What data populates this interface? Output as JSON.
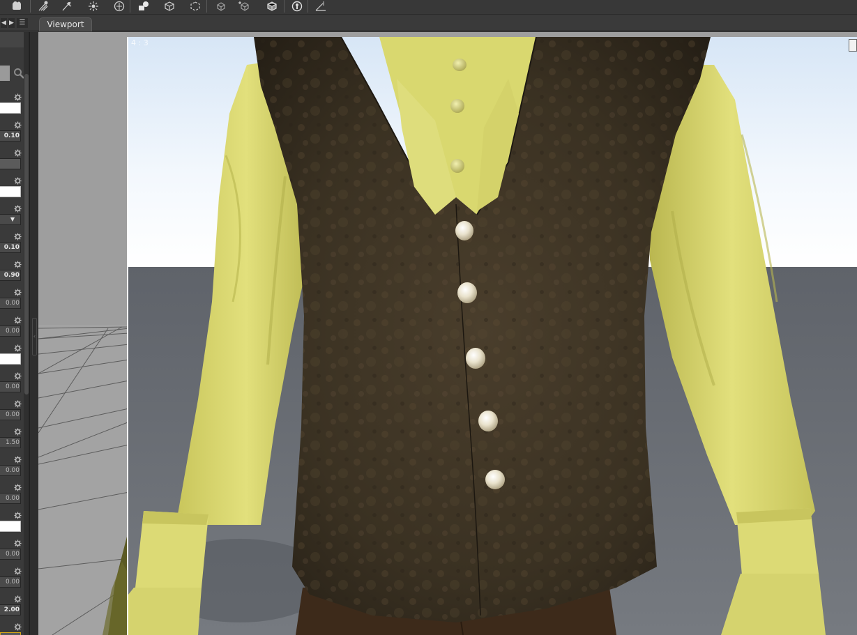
{
  "tabs": {
    "viewport_label": "Viewport"
  },
  "viewport": {
    "aspect_ratio": "4 : 3"
  },
  "parameters": {
    "rows": [
      {
        "value": "",
        "kind": "white"
      },
      {
        "value": "0.10",
        "kind": "normal"
      },
      {
        "value": "",
        "kind": "gray"
      },
      {
        "value": "",
        "kind": "white"
      },
      {
        "value": "▼",
        "kind": "dropdown"
      },
      {
        "value": "0.10",
        "kind": "normal"
      },
      {
        "value": "0.90",
        "kind": "normal"
      },
      {
        "value": "0.00",
        "kind": "dim"
      },
      {
        "value": "0.00",
        "kind": "dim"
      },
      {
        "value": "",
        "kind": "white"
      },
      {
        "value": "0.00",
        "kind": "dim"
      },
      {
        "value": "0.00",
        "kind": "dim"
      },
      {
        "value": "1.50",
        "kind": "dim"
      },
      {
        "value": "0.00",
        "kind": "dim"
      },
      {
        "value": "0.00",
        "kind": "dim"
      },
      {
        "value": "",
        "kind": "white"
      },
      {
        "value": "0.00",
        "kind": "dim"
      },
      {
        "value": "0.00",
        "kind": "dim"
      },
      {
        "value": "2.00",
        "kind": "normal"
      },
      {
        "value": "",
        "kind": "selected"
      }
    ]
  },
  "toolbar": {
    "icons": [
      "figure-camera-icon",
      "spot-light-icon",
      "point-light-icon",
      "distant-light-icon",
      "linear-light-icon",
      "primitive-shapes-icon",
      "node-icon",
      "transform-nodes-icon",
      "geometry-icon",
      "add-geometry-icon",
      "geometry-editor-icon",
      "joint-editor-icon",
      "measure-icon"
    ]
  },
  "colors": {
    "shirt": "#d9d86f",
    "vest": "#3b3223",
    "sky": "#ffffff",
    "floor": "#6f7278",
    "accent": "#d4a418"
  }
}
